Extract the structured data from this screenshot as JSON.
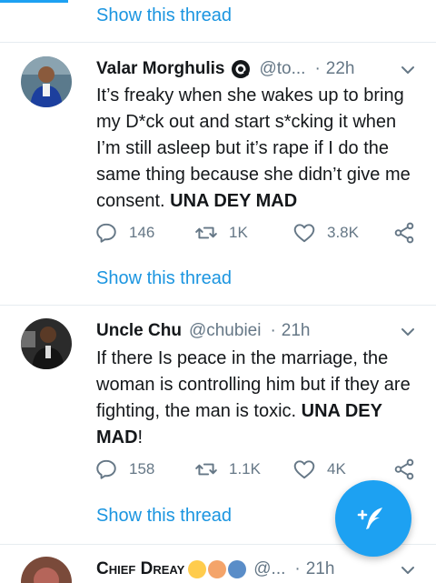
{
  "thread_link_label": "Show this thread",
  "tweets": [
    {
      "name": "Valar Morghulis",
      "handle": "@to...",
      "time": "22h",
      "text_parts": [
        "It’s freaky when she wakes up to bring my D*ck out and start s*cking it when I’m still asleep but it’s rape if I do the same thing because she didn’t give me consent. ",
        "UNA DEY MAD",
        ""
      ],
      "replies": "146",
      "retweets": "1K",
      "likes": "3.8K"
    },
    {
      "name": "Uncle Chu",
      "handle": "@chubiei",
      "time": "21h",
      "text_parts": [
        "If there Is peace in the marriage, the woman is controlling him but if they are fighting, the man is toxic. ",
        "UNA DEY MAD",
        "!"
      ],
      "replies": "158",
      "retweets": "1.1K",
      "likes": "4K"
    },
    {
      "name": "Chief Dreay",
      "handle": "@...",
      "time": "21h"
    }
  ],
  "icons": {
    "reply": "reply-icon",
    "retweet": "retweet-icon",
    "like": "heart-icon",
    "share": "share-icon",
    "compose": "compose-tweet-icon",
    "more": "chevron-down-icon",
    "badge": "eye-badge-icon"
  },
  "colors": {
    "accent": "#1da1f2",
    "link": "#1b95e0",
    "muted": "#657786",
    "text": "#14171a"
  }
}
